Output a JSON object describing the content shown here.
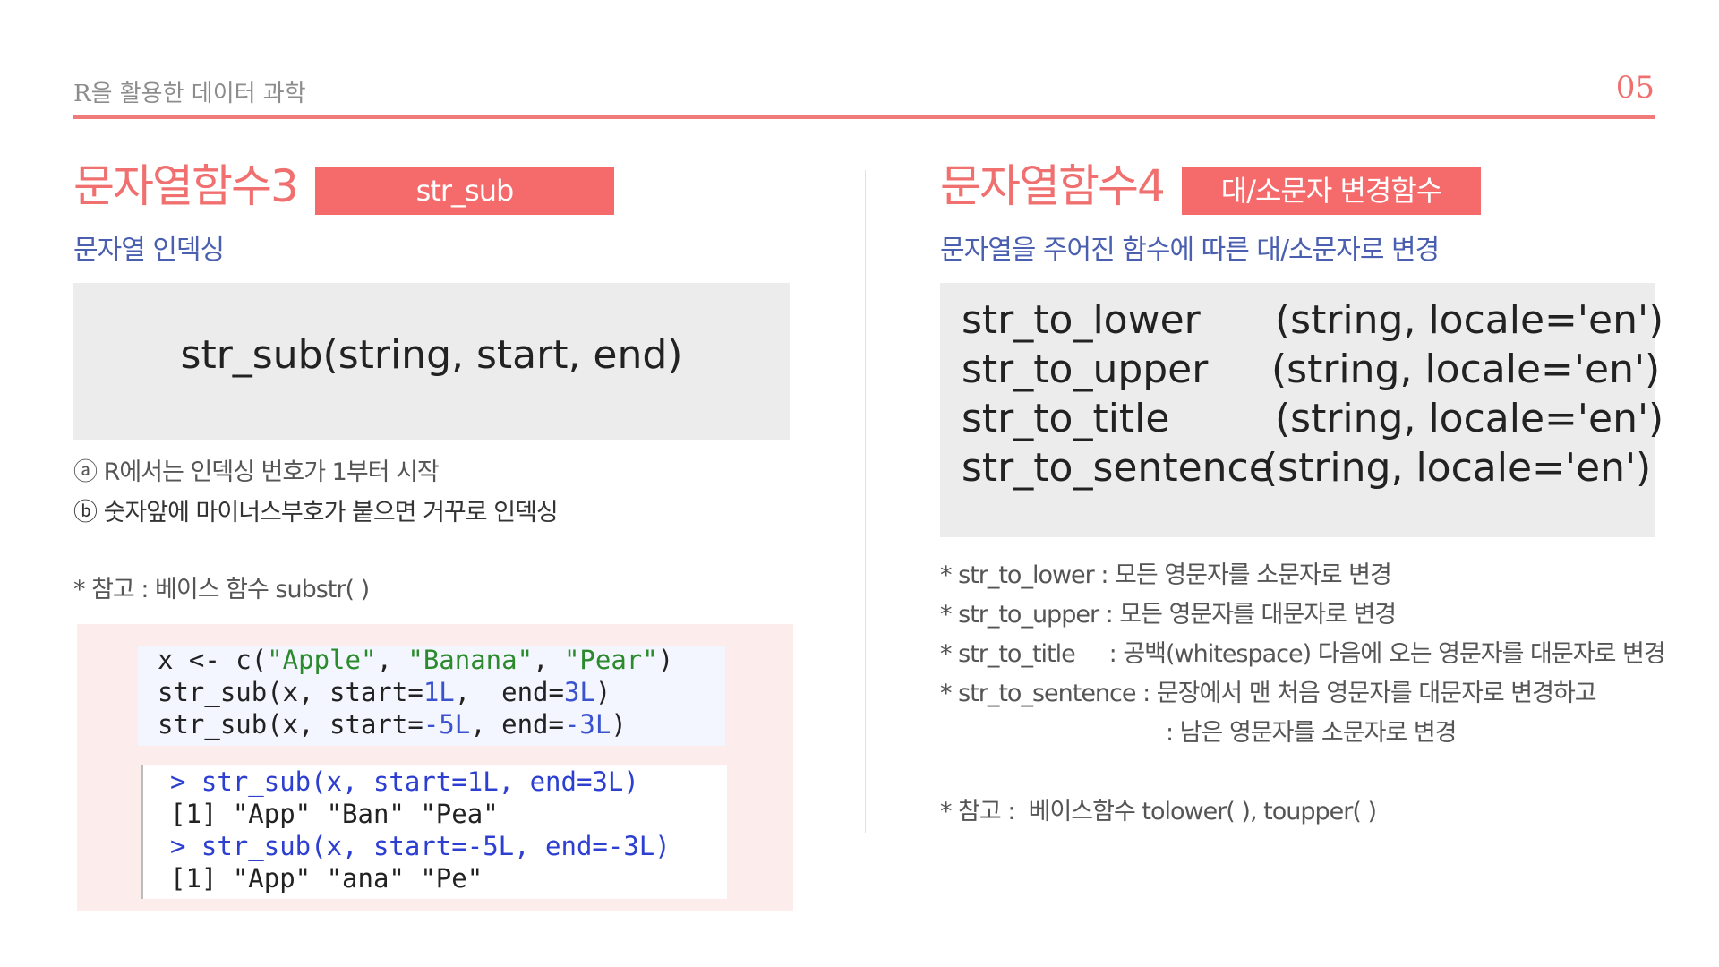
{
  "header": {
    "title": "R을 활용한 데이터 과학",
    "page_number": "05"
  },
  "left": {
    "title": "문자열함수3",
    "tag": "str_sub",
    "subtitle": "문자열 인덱싱",
    "signature": "str_sub(string, start, end)",
    "note_a": "ⓐ R에서는 인덱싱 번호가 1부터 시작",
    "note_b": "ⓑ 숫자앞에 마이너스부호가 붙으면 거꾸로 인덱싱",
    "reference": "* 참고 : 베이스 함수 substr( )",
    "code": {
      "line1": {
        "a": "x <- c(",
        "s1": "\"Apple\"",
        "c1": ", ",
        "s2": "\"Banana\"",
        "c2": ", ",
        "s3": "\"Pear\"",
        "end": ")"
      },
      "line2": {
        "a": "str_sub(x, start=",
        "n1": "1L",
        "b": ",  end=",
        "n2": "3L",
        "end": ")"
      },
      "line3": {
        "a": "str_sub(x, start=",
        "n1": "-5L",
        "b": ", end=",
        "n2": "-3L",
        "end": ")"
      }
    },
    "console": {
      "line1": "> str_sub(x, start=1L, end=3L)",
      "line2": "[1] \"App\" \"Ban\" \"Pea\"",
      "line3": "> str_sub(x, start=-5L, end=-3L)",
      "line4": "[1] \"App\" \"ana\" \"Pe\""
    }
  },
  "right": {
    "title": "문자열함수4",
    "tag": "대/소문자 변경함수",
    "subtitle": "문자열을 주어진 함수에 따른 대/소문자로 변경",
    "functions": [
      {
        "name": "str_to_lower",
        "args": "(string, locale='en')"
      },
      {
        "name": "str_to_upper",
        "args": "(string, locale='en')"
      },
      {
        "name": "str_to_title",
        "args": "(string, locale='en')"
      },
      {
        "name": "str_to_sentence",
        "args": "(string, locale='en')"
      }
    ],
    "descriptions": [
      "* str_to_lower : 모든 영문자를 소문자로 변경",
      "* str_to_upper : 모든 영문자를 대문자로 변경",
      "* str_to_title     : 공백(whitespace) 다음에 오는 영문자를 대문자로 변경",
      "* str_to_sentence : 문장에서 맨 처음 영문자를 대문자로 변경하고",
      ": 남은 영문자를 소문자로 변경"
    ],
    "reference": "* 참고 :  베이스함수 tolower( ), toupper( )"
  }
}
